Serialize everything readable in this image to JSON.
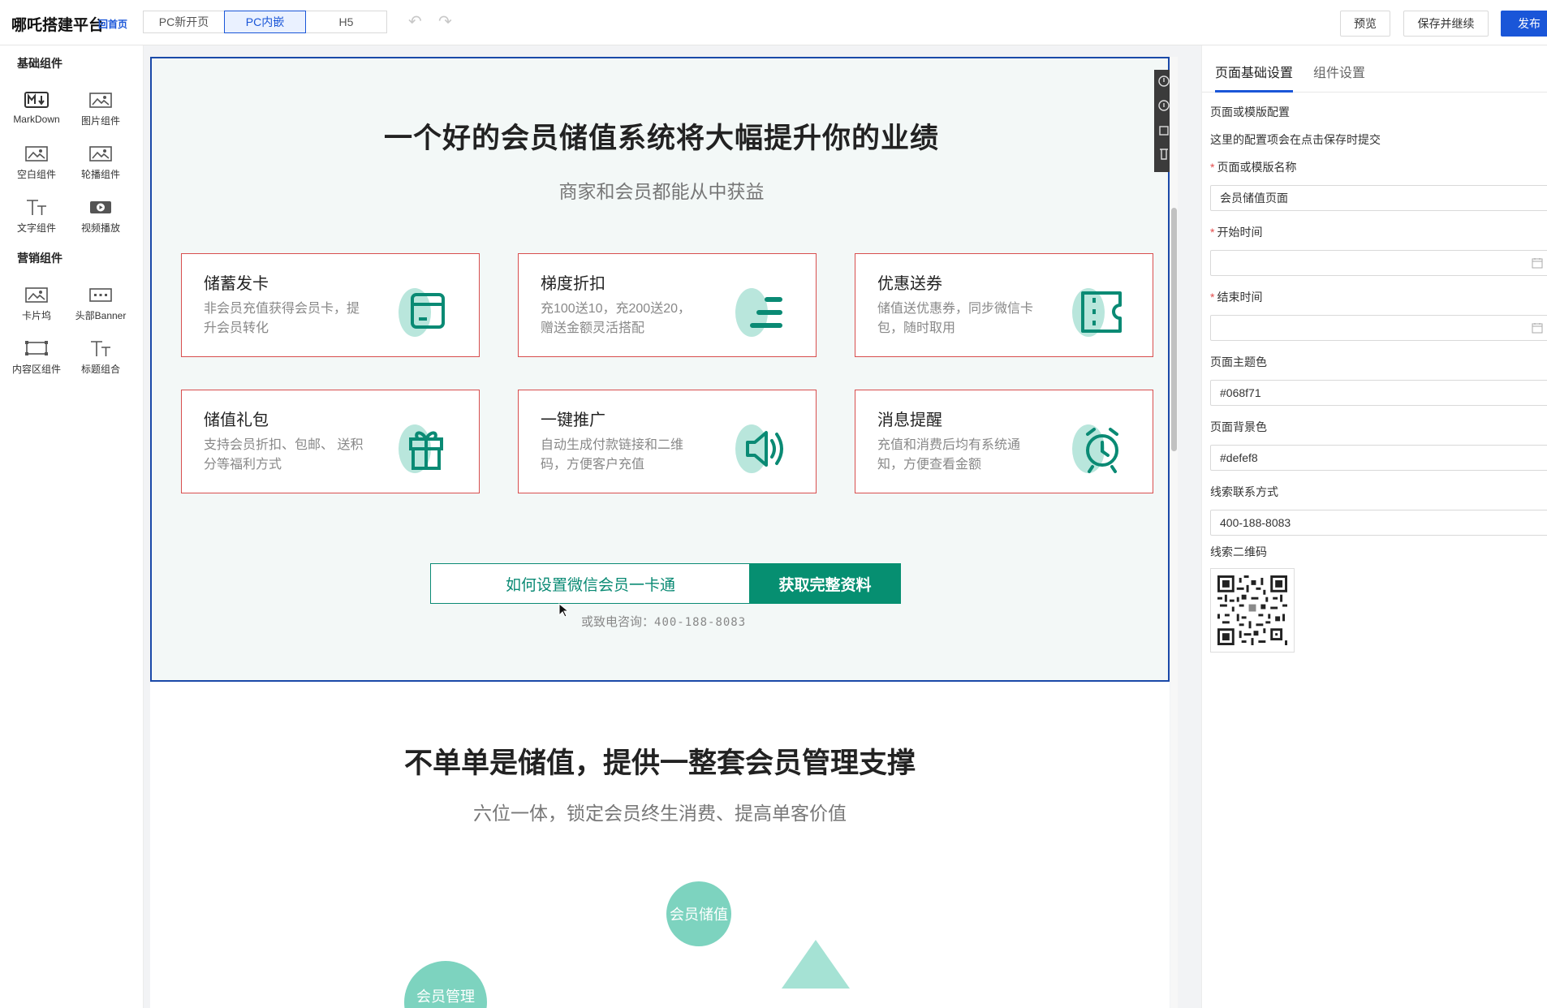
{
  "topbar": {
    "brand": "哪吒搭建平台",
    "home_link": "回首页",
    "modes": [
      "PC新开页",
      "PC内嵌",
      "H5"
    ],
    "active_mode": "PC内嵌",
    "preview_label": "预览",
    "save_label": "保存并继续",
    "publish_label": "发布"
  },
  "left": {
    "basic_title": "基础组件",
    "basic_items": [
      {
        "label": "MarkDown",
        "icon": "markdown-icon"
      },
      {
        "label": "图片组件",
        "icon": "image-icon"
      },
      {
        "label": "空白组件",
        "icon": "image-icon"
      },
      {
        "label": "轮播组件",
        "icon": "image-icon"
      },
      {
        "label": "文字组件",
        "icon": "text-icon"
      },
      {
        "label": "视频播放",
        "icon": "video-icon"
      }
    ],
    "marketing_title": "营销组件",
    "marketing_items": [
      {
        "label": "卡片坞",
        "icon": "image-icon"
      },
      {
        "label": "头部Banner",
        "icon": "banner-icon"
      },
      {
        "label": "内容区组件",
        "icon": "content-area-icon"
      },
      {
        "label": "标题组合",
        "icon": "text-icon"
      }
    ]
  },
  "canvas": {
    "title": "一个好的会员储值系统将大幅提升你的业绩",
    "subtitle": "商家和会员都能从中获益",
    "cards": [
      {
        "title": "储蓄发卡",
        "desc": "非会员充值获得会员卡，提升会员转化",
        "icon": "card-icon"
      },
      {
        "title": "梯度折扣",
        "desc": "充100送10，充200送20，赠送金额灵活搭配",
        "icon": "tier-icon"
      },
      {
        "title": "优惠送券",
        "desc": "储值送优惠券，同步微信卡包，随时取用",
        "icon": "coupon-icon"
      },
      {
        "title": "储值礼包",
        "desc": "支持会员折扣、包邮、 送积分等福利方式",
        "icon": "gift-icon"
      },
      {
        "title": "一键推广",
        "desc": "自动生成付款链接和二维码，方便客户充值",
        "icon": "speaker-icon"
      },
      {
        "title": "消息提醒",
        "desc": "充值和消费后均有系统通知，方便查看金额",
        "icon": "alarm-icon"
      }
    ],
    "cta_left": "如何设置微信会员一卡通",
    "cta_right": "获取完整资料",
    "phone_prefix": "或致电咨询：",
    "phone_number": "400-188-8083",
    "section2_title": "不单单是储值，提供一整套会员管理支撑",
    "section2_subtitle": "六位一体，锁定会员终生消费、提高单客价值",
    "bubble_center": "会员储值",
    "bubble_left": "会员管理"
  },
  "right": {
    "tabs": [
      "页面基础设置",
      "组件设置"
    ],
    "section_label": "页面或模版配置",
    "hint": "这里的配置项会在点击保存时提交",
    "name_label": "页面或模版名称",
    "name_value": "会员储值页面",
    "start_label": "开始时间",
    "start_value": "",
    "end_label": "结束时间",
    "end_value": "",
    "theme_label": "页面主题色",
    "theme_value": "#068f71",
    "bg_label": "页面背景色",
    "bg_value": "#defef8",
    "contact_label": "线索联系方式",
    "contact_value": "400-188-8083",
    "qr_label": "线索二维码"
  },
  "colors": {
    "accent": "#1a56d8",
    "theme": "#068f71",
    "card_border": "#d84e4e",
    "icon_bg": "#b9e6dc"
  }
}
